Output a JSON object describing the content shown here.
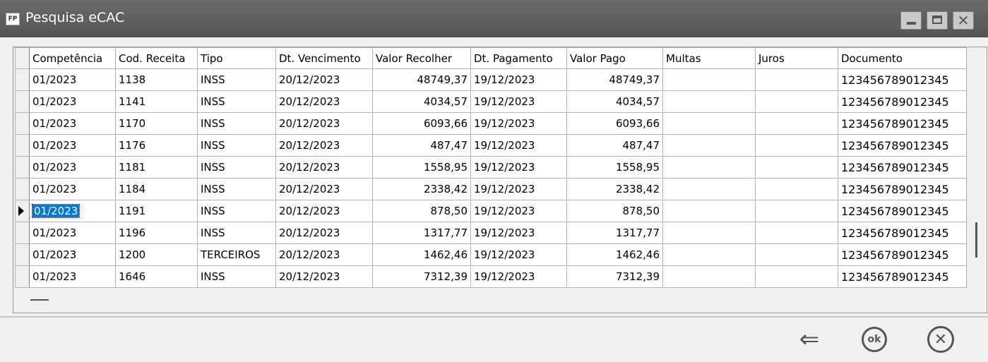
{
  "window": {
    "title": "Pesquisa eCAC",
    "app_icon_label": "FP"
  },
  "grid": {
    "columns": [
      "Competência",
      "Cod. Receita",
      "Tipo",
      "Dt. Vencimento",
      "Valor Recolher",
      "Dt. Pagamento",
      "Valor Pago",
      "Multas",
      "Juros",
      "Documento"
    ],
    "rows": [
      [
        "01/2023",
        "1138",
        "INSS",
        "20/12/2023",
        "48749,37",
        "19/12/2023",
        "48749,37",
        "",
        "",
        "123456789012345"
      ],
      [
        "01/2023",
        "1141",
        "INSS",
        "20/12/2023",
        "4034,57",
        "19/12/2023",
        "4034,57",
        "",
        "",
        "123456789012345"
      ],
      [
        "01/2023",
        "1170",
        "INSS",
        "20/12/2023",
        "6093,66",
        "19/12/2023",
        "6093,66",
        "",
        "",
        "123456789012345"
      ],
      [
        "01/2023",
        "1176",
        "INSS",
        "20/12/2023",
        "487,47",
        "19/12/2023",
        "487,47",
        "",
        "",
        "123456789012345"
      ],
      [
        "01/2023",
        "1181",
        "INSS",
        "20/12/2023",
        "1558,95",
        "19/12/2023",
        "1558,95",
        "",
        "",
        "123456789012345"
      ],
      [
        "01/2023",
        "1184",
        "INSS",
        "20/12/2023",
        "2338,42",
        "19/12/2023",
        "2338,42",
        "",
        "",
        "123456789012345"
      ],
      [
        "01/2023",
        "1191",
        "INSS",
        "20/12/2023",
        "878,50",
        "19/12/2023",
        "878,50",
        "",
        "",
        "123456789012345"
      ],
      [
        "01/2023",
        "1196",
        "INSS",
        "20/12/2023",
        "1317,77",
        "19/12/2023",
        "1317,77",
        "",
        "",
        "123456789012345"
      ],
      [
        "01/2023",
        "1200",
        "TERCEIROS",
        "20/12/2023",
        "1462,46",
        "19/12/2023",
        "1462,46",
        "",
        "",
        "123456789012345"
      ],
      [
        "01/2023",
        "1646",
        "INSS",
        "20/12/2023",
        "7312,39",
        "19/12/2023",
        "7312,39",
        "",
        "",
        "123456789012345"
      ]
    ],
    "selected_row": 6
  },
  "footer": {
    "back_icon": "back-arrow-icon",
    "ok_label": "ok",
    "cancel_icon": "cancel-icon"
  },
  "colors": {
    "titlebar": "#5e5e5e",
    "selection": "#0078d7"
  }
}
